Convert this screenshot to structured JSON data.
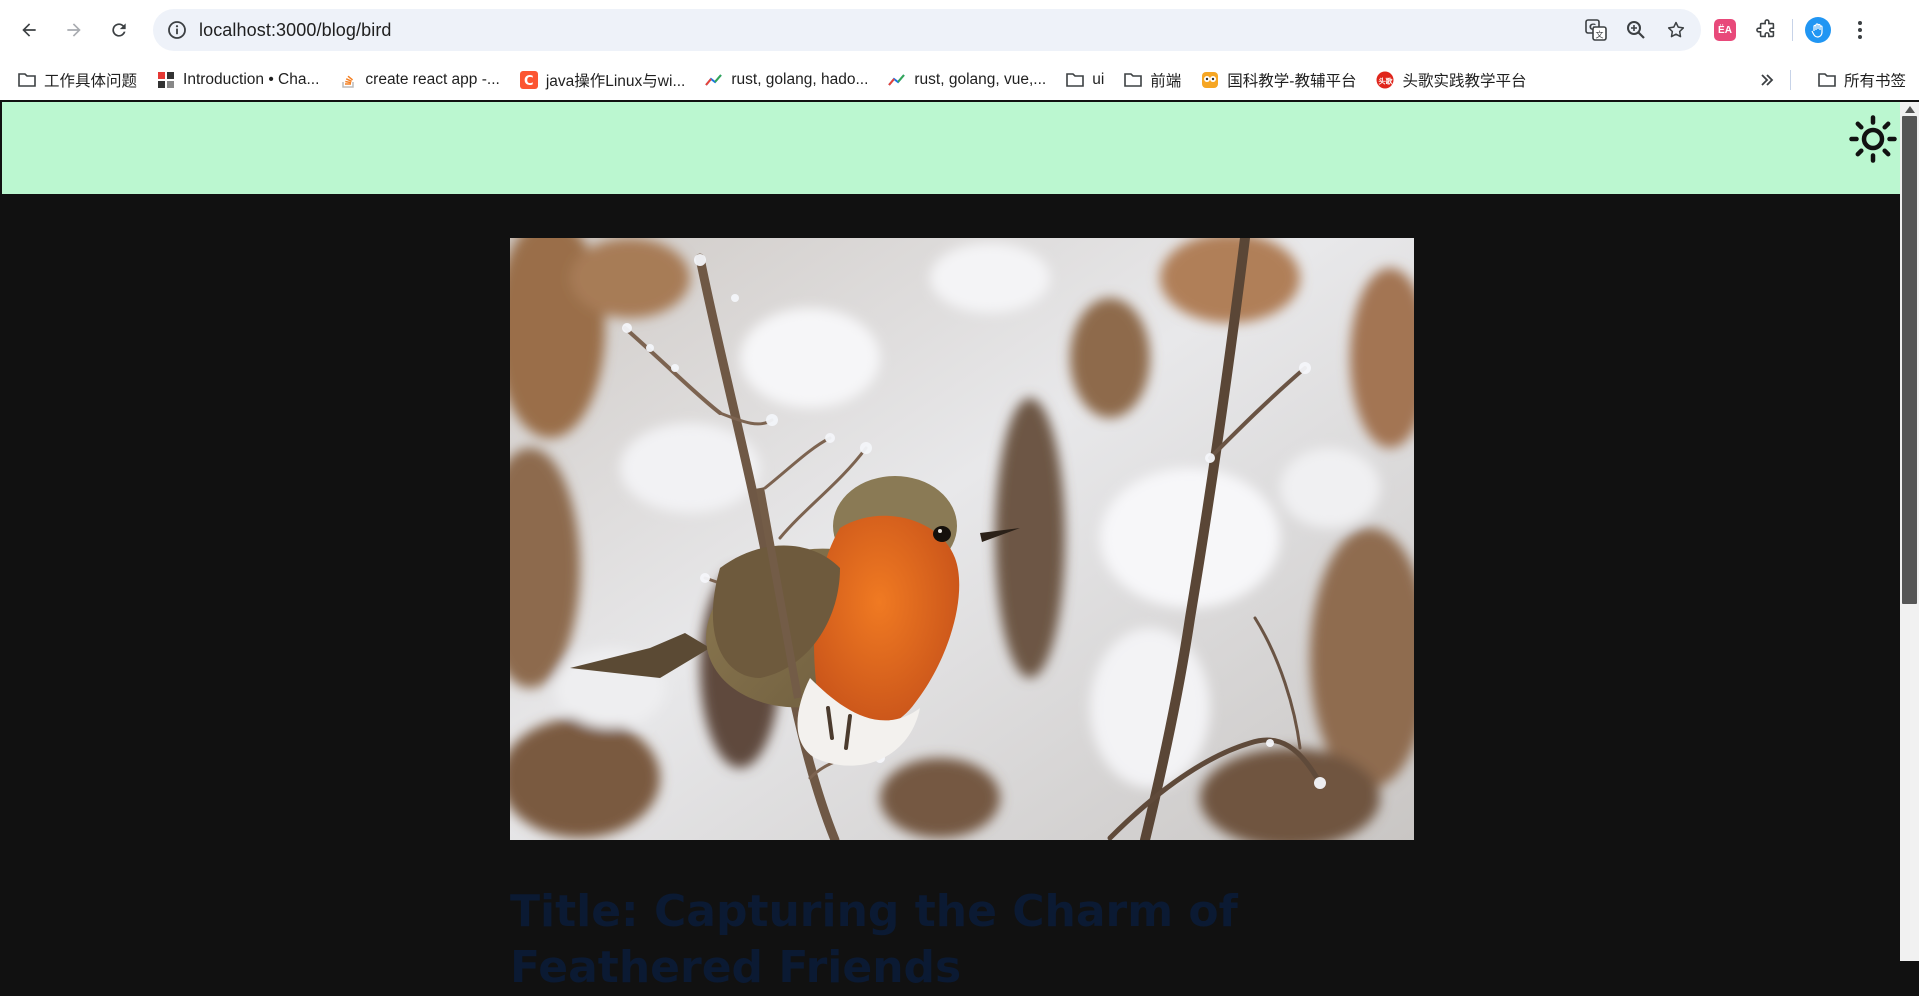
{
  "browser": {
    "url": "localhost:3000/blog/bird",
    "ext_badge": "ЁА"
  },
  "bookmarks": [
    {
      "label": "工作具体问题",
      "icon": "folder-icon"
    },
    {
      "label": "Introduction • Cha...",
      "icon": "chakra-favicon"
    },
    {
      "label": "create react app -...",
      "icon": "stackoverflow-favicon"
    },
    {
      "label": "java操作Linux与wi...",
      "icon": "csdn-favicon"
    },
    {
      "label": "rust, golang, hado...",
      "icon": "trend-favicon"
    },
    {
      "label": "rust, golang, vue,...",
      "icon": "trend-favicon"
    },
    {
      "label": "ui",
      "icon": "folder-icon"
    },
    {
      "label": "前端",
      "icon": "folder-icon"
    },
    {
      "label": "国科教学-教辅平台",
      "icon": "owl-favicon"
    },
    {
      "label": "头歌实践教学平台",
      "icon": "toutiao-favicon"
    }
  ],
  "bookmarks_all": "所有书签",
  "page": {
    "header_color": "#bbf7d0",
    "background_color": "#111111",
    "hero_alt": "European robin perched on a frosted branch in snow",
    "title": "Title: Capturing the Charm of Feathered Friends"
  }
}
